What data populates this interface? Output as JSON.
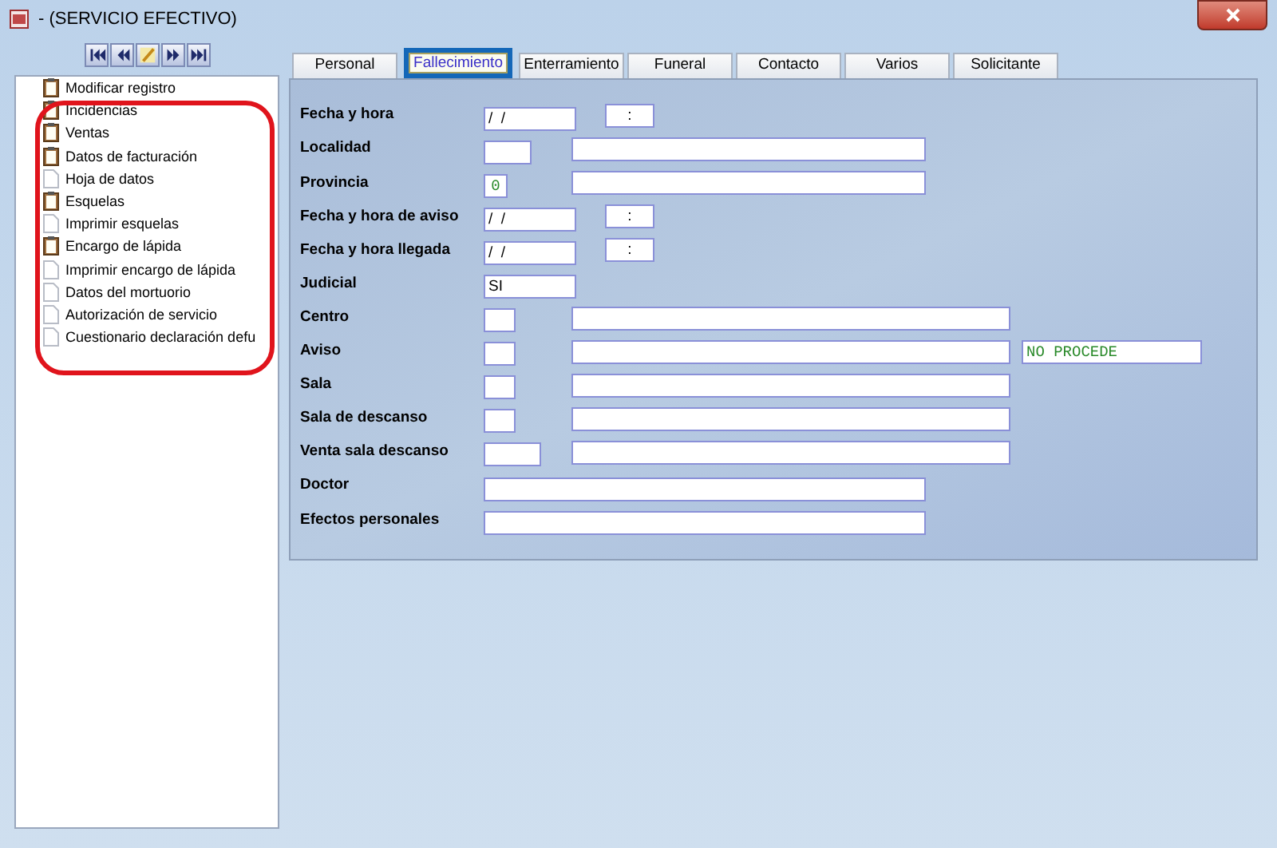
{
  "window": {
    "title": "- (SERVICIO EFECTIVO)"
  },
  "nav_buttons": [
    {
      "kind": "first"
    },
    {
      "kind": "prev"
    },
    {
      "kind": "edit"
    },
    {
      "kind": "next"
    },
    {
      "kind": "last"
    }
  ],
  "sidebar": {
    "items": [
      {
        "label": "Modificar registro",
        "kind": "clipboard"
      },
      {
        "label": "Incidencias",
        "kind": "clipboard"
      },
      {
        "label": "Ventas",
        "kind": "clipboard"
      },
      {
        "label": "Datos de facturación",
        "kind": "clipboard"
      },
      {
        "label": "Hoja de datos",
        "kind": "page"
      },
      {
        "label": "Esquelas",
        "kind": "clipboard"
      },
      {
        "label": "Imprimir esquelas",
        "kind": "page"
      },
      {
        "label": "Encargo de lápida",
        "kind": "clipboard"
      },
      {
        "label": "Imprimir encargo de lápida",
        "kind": "page"
      },
      {
        "label": "Datos del mortuorio",
        "kind": "page"
      },
      {
        "label": "Autorización de servicio",
        "kind": "page"
      },
      {
        "label": "Cuestionario declaración defu",
        "kind": "page"
      }
    ]
  },
  "tabs": [
    {
      "label": "Personal",
      "selected": false
    },
    {
      "label": "Fallecimiento",
      "selected": true
    },
    {
      "label": "Enterramiento",
      "selected": false
    },
    {
      "label": "Funeral",
      "selected": false
    },
    {
      "label": "Contacto",
      "selected": false
    },
    {
      "label": "Varios",
      "selected": false
    },
    {
      "label": "Solicitante",
      "selected": false
    }
  ],
  "form": [
    {
      "label": "Fecha y hora",
      "fields": [
        {
          "kind": "date",
          "value": "/  /"
        },
        {
          "kind": "time",
          "value": ":"
        }
      ]
    },
    {
      "label": "Localidad",
      "fields": [
        {
          "kind": "code"
        },
        {
          "kind": "name"
        }
      ]
    },
    {
      "label": "Provincia",
      "fields": [
        {
          "kind": "tiny",
          "value": "0"
        },
        {
          "kind": "name"
        }
      ]
    },
    {
      "label": "Fecha y hora de aviso",
      "fields": [
        {
          "kind": "date",
          "value": "/  /"
        },
        {
          "kind": "time",
          "value": ":"
        }
      ]
    },
    {
      "label": "Fecha y hora llegada",
      "fields": [
        {
          "kind": "date",
          "value": "/  /"
        },
        {
          "kind": "time",
          "value": ":"
        }
      ]
    },
    {
      "label": "Judicial",
      "fields": [
        {
          "kind": "date",
          "value": "SI"
        }
      ]
    },
    {
      "label": "Centro",
      "fields": [
        {
          "kind": "box"
        },
        {
          "kind": "long"
        }
      ]
    },
    {
      "label": "Aviso",
      "fields": [
        {
          "kind": "box"
        },
        {
          "kind": "long"
        },
        {
          "kind": "note",
          "value": "NO PROCEDE"
        }
      ]
    },
    {
      "label": "Sala",
      "fields": [
        {
          "kind": "box"
        },
        {
          "kind": "long"
        }
      ]
    },
    {
      "label": "Sala de descanso",
      "fields": [
        {
          "kind": "box"
        },
        {
          "kind": "long"
        }
      ]
    },
    {
      "label": "Venta sala descanso",
      "fields": [
        {
          "kind": "mid"
        },
        {
          "kind": "long"
        }
      ]
    },
    {
      "label": "Doctor",
      "fields": [
        {
          "kind": "full"
        }
      ]
    },
    {
      "label": "Efectos personales",
      "fields": [
        {
          "kind": "full"
        }
      ]
    }
  ]
}
